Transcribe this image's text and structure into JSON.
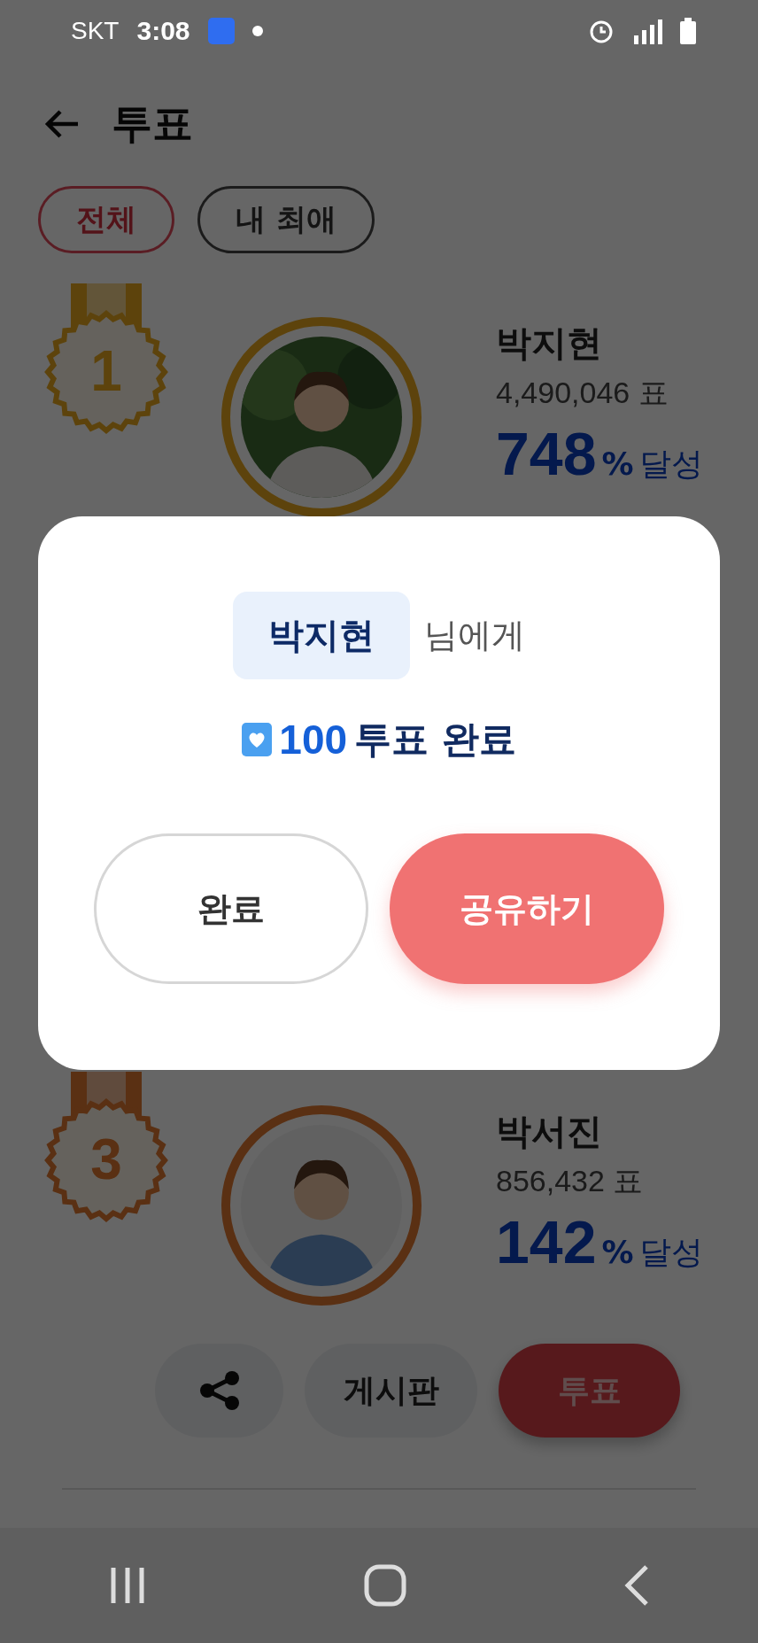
{
  "status_bar": {
    "carrier": "SKT",
    "time": "3:08"
  },
  "header": {
    "title": "투표"
  },
  "filters": [
    {
      "label": "전체",
      "selected": true
    },
    {
      "label": "내 최애",
      "selected": false
    }
  ],
  "ranking": [
    {
      "rank": "1",
      "kind": "gold",
      "name": "박지현",
      "votes": "4,490,046 표",
      "percent": "748",
      "percent_suffix": "%",
      "achieved": "달성"
    },
    {
      "rank": "3",
      "kind": "bronze",
      "name": "박서진",
      "votes": "856,432 표",
      "percent": "142",
      "percent_suffix": "%",
      "achieved": "달성",
      "actions": {
        "board": "게시판",
        "vote": "투표"
      }
    }
  ],
  "dialog": {
    "recipient": "박지현",
    "recipient_suffix": "님에게",
    "amount": "100",
    "message": "투표 완료",
    "buttons": [
      {
        "label": "완료",
        "kind": "secondary"
      },
      {
        "label": "공유하기",
        "kind": "primary"
      }
    ]
  }
}
